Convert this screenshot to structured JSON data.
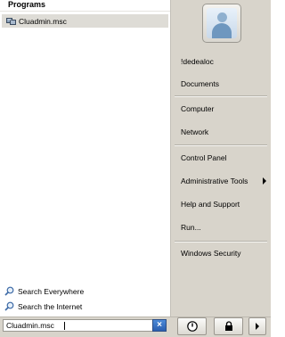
{
  "programs_header": "Programs",
  "program_item": {
    "label": "Cluadmin.msc",
    "icon": "cluster-admin-icon"
  },
  "right_menu": [
    {
      "label": "!dedealoc",
      "submenu": false
    },
    {
      "label": "Documents",
      "submenu": false
    },
    {
      "label": "Computer",
      "submenu": false
    },
    {
      "label": "Network",
      "submenu": false
    },
    {
      "label": "Control Panel",
      "submenu": false
    },
    {
      "label": "Administrative Tools",
      "submenu": true
    },
    {
      "label": "Help and Support",
      "submenu": false
    },
    {
      "label": "Run...",
      "submenu": false
    },
    {
      "label": "Windows Security",
      "submenu": false
    }
  ],
  "search_links": [
    {
      "label": "Search Everywhere",
      "icon": "search-icon"
    },
    {
      "label": "Search the Internet",
      "icon": "search-icon"
    }
  ],
  "search_box": {
    "value": "Cluadmin.msc"
  },
  "buttons": {
    "clear": "×",
    "power": "power-icon",
    "lock": "lock-icon",
    "more": "arrow-right-icon"
  },
  "colors": {
    "right_panel": "#d8d4cb",
    "highlight": "#dedcd6",
    "search_button": "#2a5fb0"
  }
}
